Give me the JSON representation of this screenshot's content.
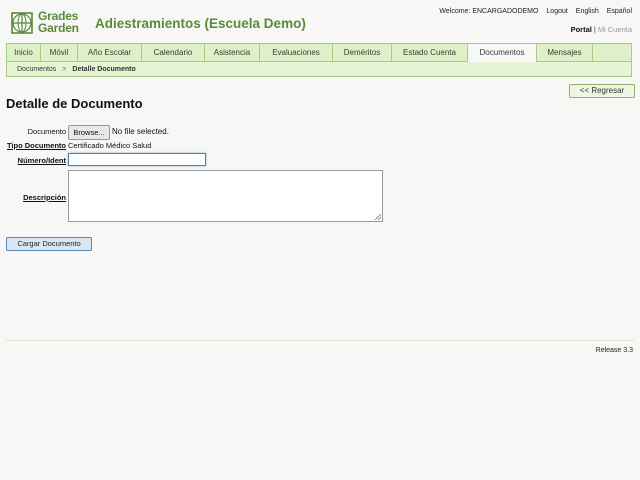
{
  "logo": {
    "line1": "Grades",
    "line2": "Garden",
    "color": "#5a8a3a"
  },
  "header": {
    "school_title": "Adiestramientos (Escuela Demo)",
    "welcome": "Welcome: ENCARGADODEMO",
    "logout": "Logout",
    "lang_en": "English",
    "lang_es": "Español",
    "portal": "Portal",
    "portal_sep": "|",
    "mi_cuenta": "Mi Cuenta"
  },
  "nav": {
    "tabs": [
      {
        "label": "Inicio"
      },
      {
        "label": "Móvil"
      },
      {
        "label": "Año Escolar"
      },
      {
        "label": "Calendario"
      },
      {
        "label": "Asistencia"
      },
      {
        "label": "Evaluaciones"
      },
      {
        "label": "Deméritos"
      },
      {
        "label": "Estado Cuenta"
      },
      {
        "label": "Documentos",
        "active": true
      },
      {
        "label": "Mensajes"
      }
    ]
  },
  "breadcrumb": {
    "parent": "Documentos",
    "sep": ">",
    "current": "Detalle Documento"
  },
  "back_button": "<< Regresar",
  "page_title": "Detalle de Documento",
  "form": {
    "documento_label": "Documento",
    "browse_label": "Browse...",
    "file_status": "No file selected.",
    "tipo_label": "Tipo Documento",
    "tipo_value": "Certificado Médico Salud",
    "numero_label": "Número/Ident",
    "numero_value": "",
    "descripcion_label": "Descripción",
    "descripcion_value": "",
    "submit_label": "Cargar Documento"
  },
  "footer": {
    "release": "Release 3.3"
  },
  "colors": {
    "accent": "#5a8a3a",
    "nav_bg": "#dff0c8",
    "nav_border": "#a8cc84",
    "button_blue": "#d9e7f5"
  }
}
